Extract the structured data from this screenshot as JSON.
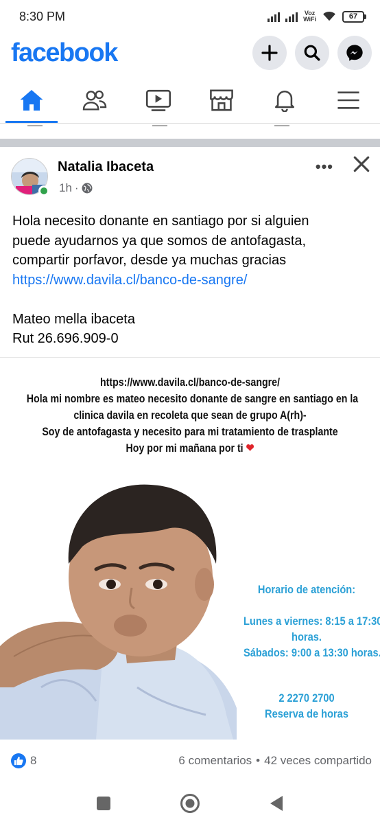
{
  "status_bar": {
    "time": "8:30 PM",
    "network_label_top": "Voz",
    "network_label_bottom": "WiFi",
    "battery_level": "67"
  },
  "header": {
    "logo_text": "facebook",
    "icons": [
      "plus-icon",
      "search-icon",
      "messenger-icon"
    ]
  },
  "nav_tabs": [
    {
      "name": "home",
      "icon": "home-icon",
      "active": true
    },
    {
      "name": "friends",
      "icon": "friends-icon",
      "active": false
    },
    {
      "name": "watch",
      "icon": "video-icon",
      "active": false
    },
    {
      "name": "marketplace",
      "icon": "store-icon",
      "active": false
    },
    {
      "name": "notifications",
      "icon": "bell-icon",
      "active": false
    },
    {
      "name": "menu",
      "icon": "hamburger-icon",
      "active": false
    }
  ],
  "post": {
    "author": "Natalia Ibaceta",
    "time": "1h",
    "separator": "·",
    "body": {
      "line1": "Hola necesito donante en santiago por si alguien",
      "line2": "puede ayudarnos ya que somos de antofagasta,",
      "line3": "compartir porfavor,  desde ya muchas gracias",
      "link": "https://www.davila.cl/banco-de-sangre/",
      "line5": "Mateo mella ibaceta",
      "line6": "Rut 26.696.909-0"
    },
    "image": {
      "url_line": "https://www.davila.cl/banco-de-sangre/",
      "line1": "Hola mi nombre es mateo necesito donante de sangre en santiago  en la",
      "line2": "clinica davila en recoleta que sean de grupo A(rh)-",
      "line3": "Soy de antofagasta y necesito para mi tratamiento de trasplante",
      "line4": "Hoy por mi mañana por ti",
      "schedule_title": "Horario de atención:",
      "schedule_weekdays_1": "Lunes a viernes: 8:15 a 17:30",
      "schedule_weekdays_2": "horas.",
      "schedule_saturday": "Sábados: 9:00 a 13:30 horas.",
      "phone": "2 2270 2700",
      "reservation": "Reserva de horas"
    },
    "likes": "8",
    "comments": "6 comentarios",
    "dot": "•",
    "shares": "42 veces compartido"
  },
  "colors": {
    "brand": "#1877f2",
    "online": "#31a24c",
    "schedule_text": "#2ba0d6"
  }
}
